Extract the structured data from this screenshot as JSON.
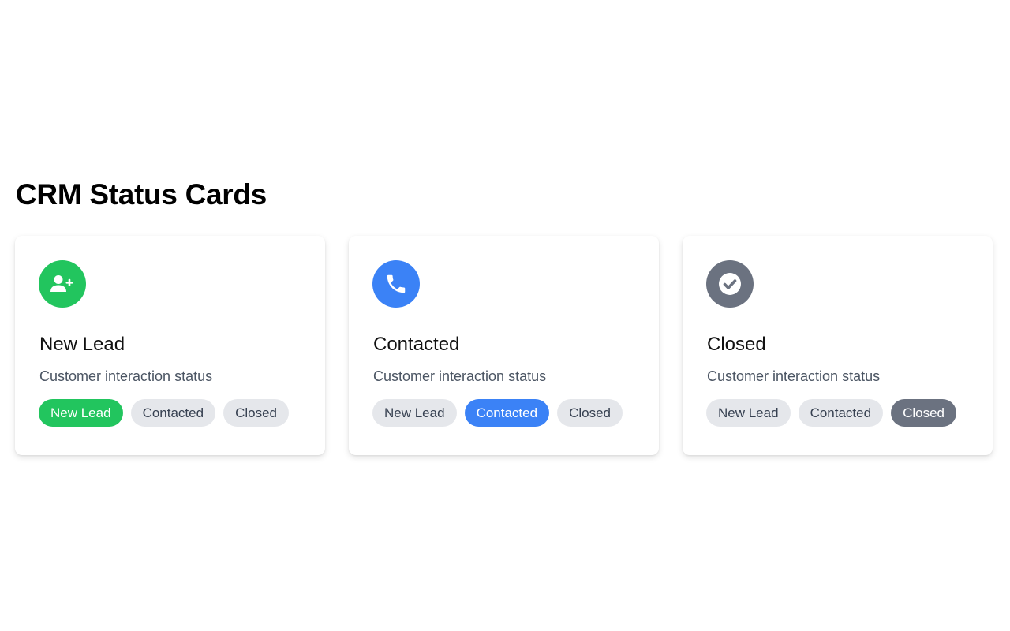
{
  "page": {
    "title": "CRM Status Cards"
  },
  "cards": [
    {
      "title": "New Lead",
      "description": "Customer interaction status",
      "icon": "user-plus-icon",
      "icon_color": "#22c55e",
      "active_status": "New Lead",
      "pills": [
        "New Lead",
        "Contacted",
        "Closed"
      ]
    },
    {
      "title": "Contacted",
      "description": "Customer interaction status",
      "icon": "phone-icon",
      "icon_color": "#3b82f6",
      "active_status": "Contacted",
      "pills": [
        "New Lead",
        "Contacted",
        "Closed"
      ]
    },
    {
      "title": "Closed",
      "description": "Customer interaction status",
      "icon": "check-circle-icon",
      "icon_color": "#6b7280",
      "active_status": "Closed",
      "pills": [
        "New Lead",
        "Contacted",
        "Closed"
      ]
    }
  ],
  "colors": {
    "pill_inactive_bg": "#e5e7eb",
    "pill_inactive_text": "#374151",
    "new_lead": "#22c55e",
    "contacted": "#3b82f6",
    "closed": "#6b7280"
  }
}
